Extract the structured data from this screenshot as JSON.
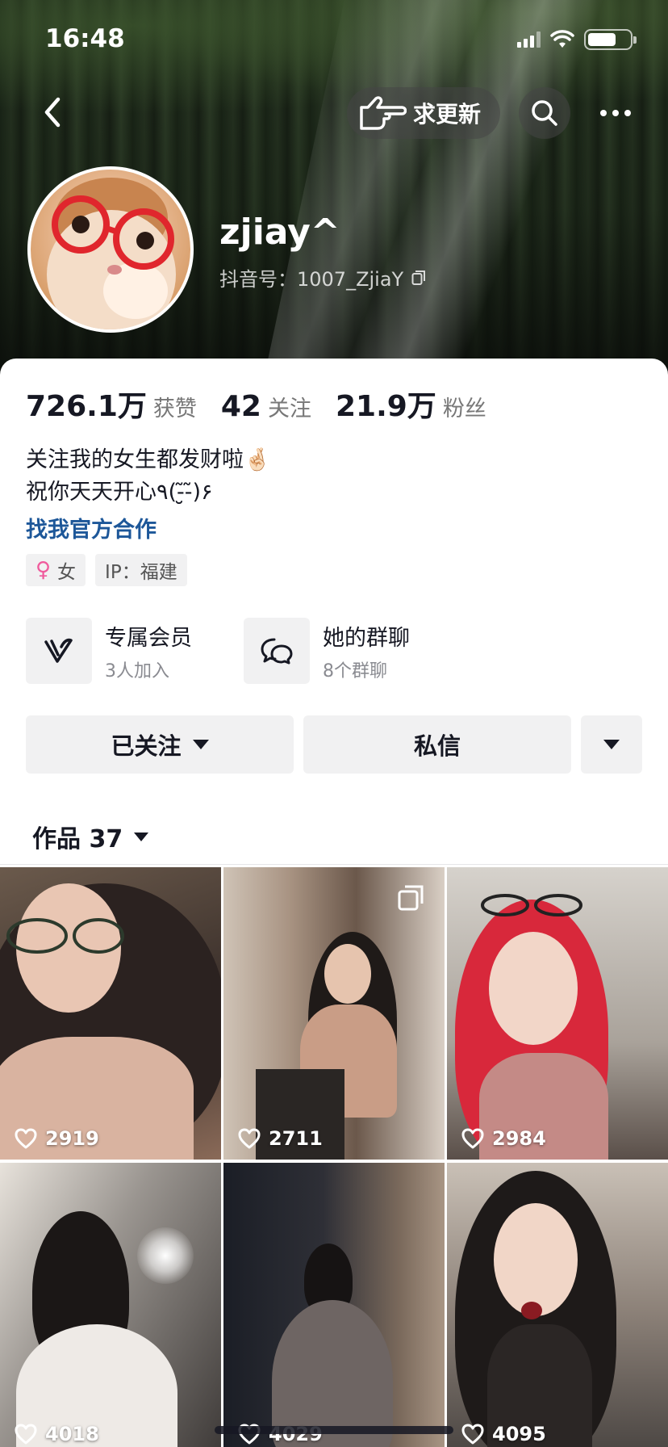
{
  "status_bar": {
    "time": "16:48"
  },
  "nav": {
    "request_update_label": "求更新",
    "icons": {
      "back": "chevron-left-icon",
      "request": "pointing-hand-icon",
      "search": "search-icon",
      "more": "more-dots-icon"
    }
  },
  "profile": {
    "username": "zjiay^",
    "douyin_id": "抖音号：1007_ZjiaY",
    "stats": [
      {
        "value": "726.1万",
        "label": "获赞"
      },
      {
        "value": "42",
        "label": "关注"
      },
      {
        "value": "21.9万",
        "label": "粉丝"
      }
    ],
    "bio_line1": "关注我的女生都发财啦🤞🏻",
    "bio_line2": "祝你天天开心٩(-̮̮̃-̃)۶",
    "business_link": "找我官方合作",
    "tags": [
      {
        "icon": "female-symbol-icon",
        "label": "女"
      },
      {
        "label": "IP：福建"
      }
    ]
  },
  "features": [
    {
      "title": "专属会员",
      "subtitle": "3人加入",
      "icon": "vip-v-icon"
    },
    {
      "title": "她的群聊",
      "subtitle": "8个群聊",
      "icon": "chat-bubbles-icon"
    }
  ],
  "actions": {
    "followed_label": "已关注",
    "message_label": "私信"
  },
  "works": {
    "tab_label": "作品 37",
    "items": [
      {
        "likes": "2919"
      },
      {
        "likes": "2711"
      },
      {
        "likes": "2984"
      },
      {
        "likes": "4018"
      },
      {
        "likes": "4029"
      },
      {
        "likes": "4095"
      }
    ]
  },
  "colors": {
    "link": "#1d5799",
    "tag_bg": "#f1f1f2",
    "text": "#161823",
    "secondary": "#8a8b91"
  }
}
